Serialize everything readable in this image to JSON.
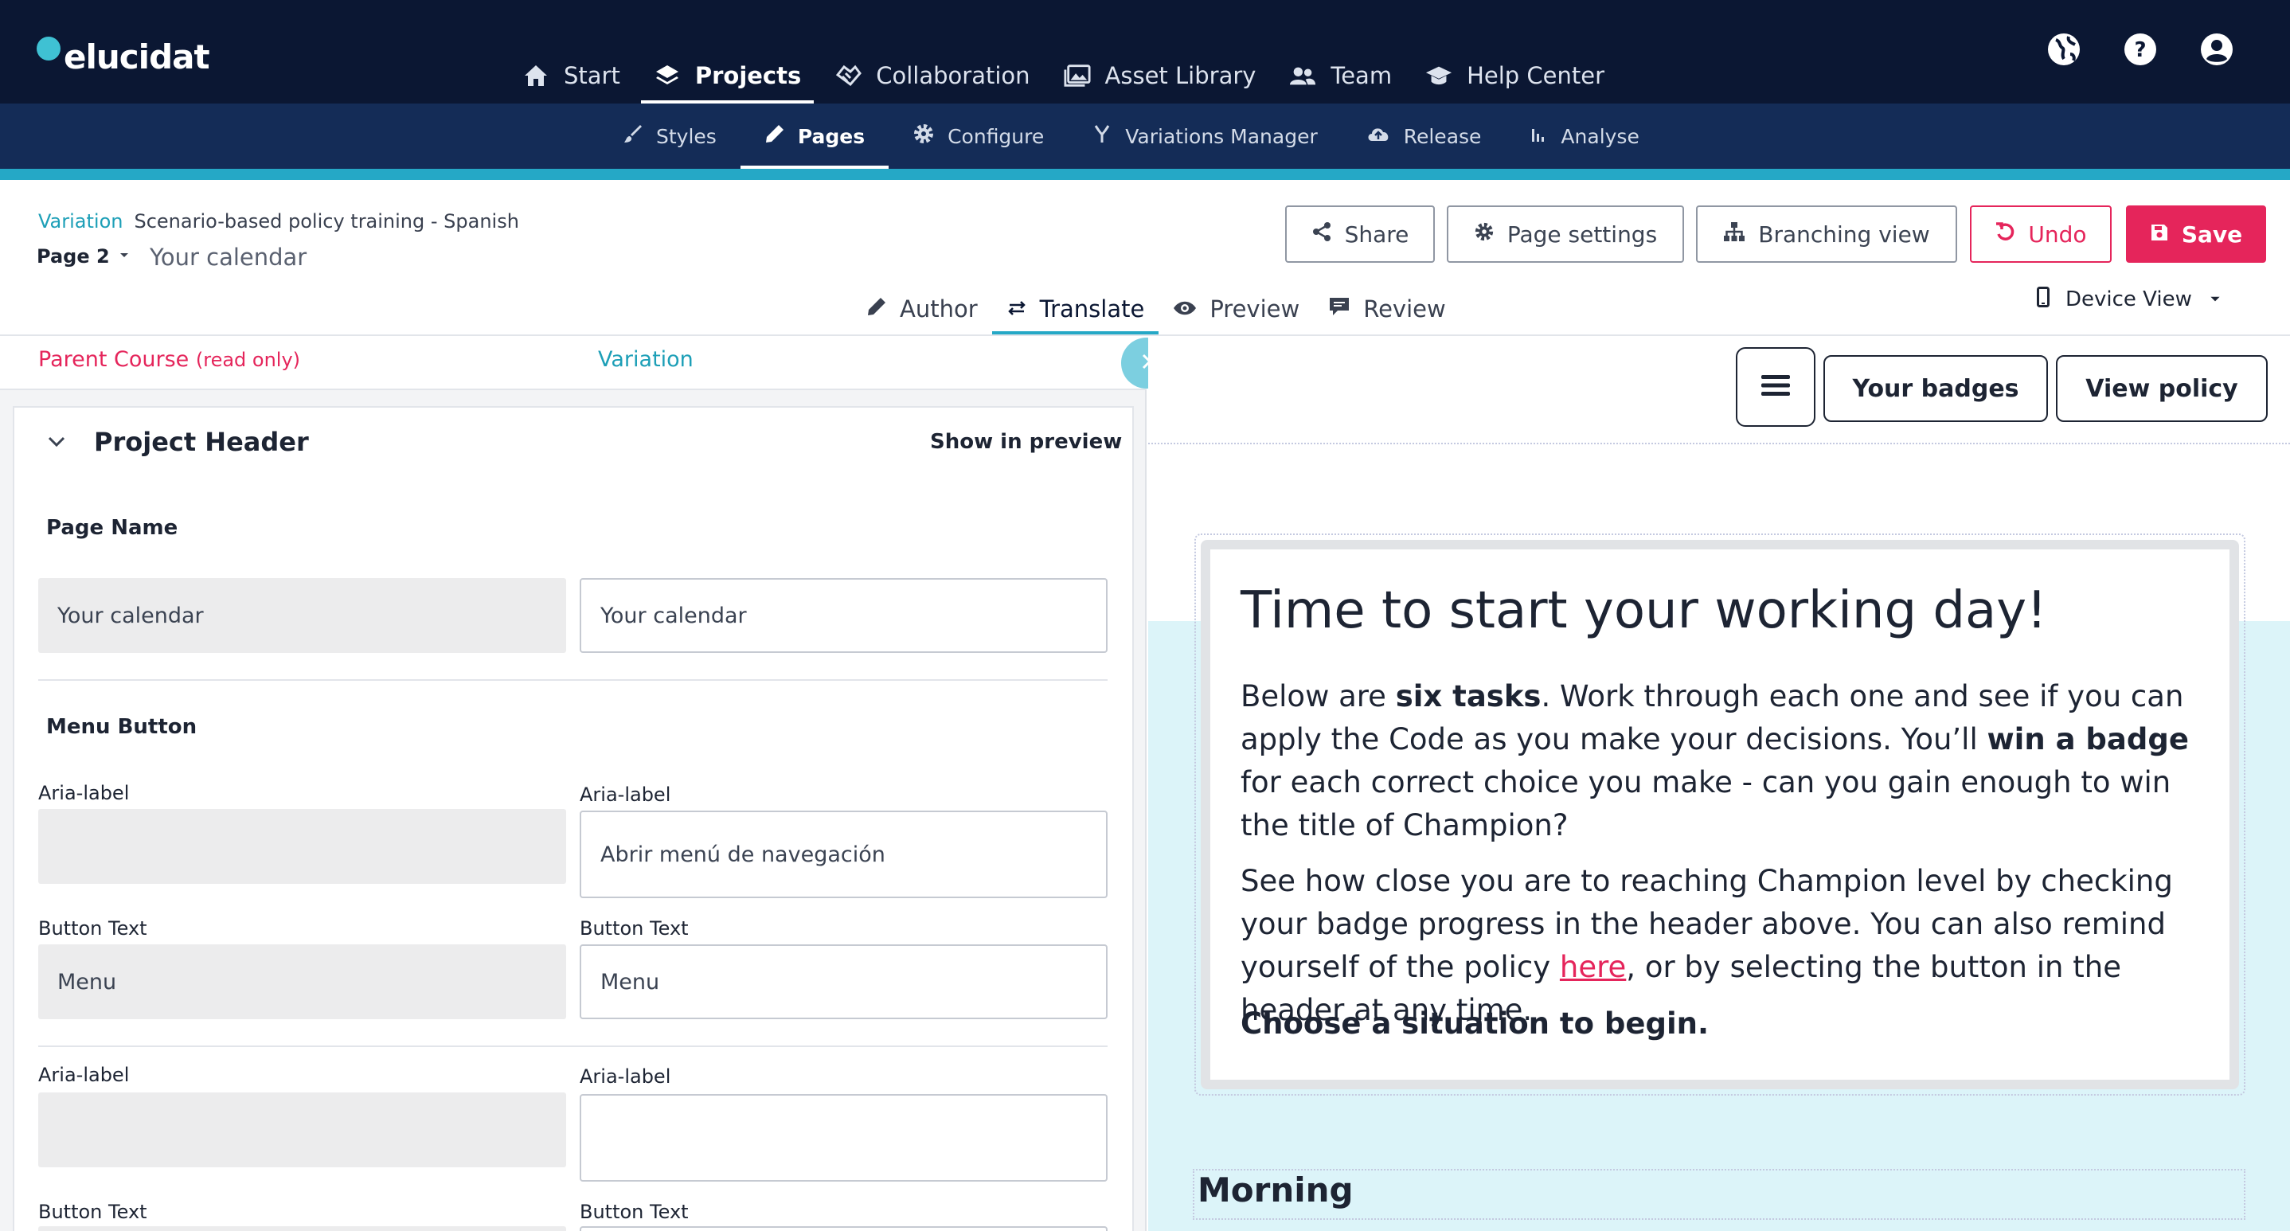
{
  "app": {
    "logo_text": "elucidat"
  },
  "main_nav": [
    {
      "label": "Start",
      "icon": "home-icon"
    },
    {
      "label": "Projects",
      "icon": "layers-icon",
      "active": true
    },
    {
      "label": "Collaboration",
      "icon": "collaboration-icon"
    },
    {
      "label": "Asset Library",
      "icon": "images-icon"
    },
    {
      "label": "Team",
      "icon": "team-icon"
    },
    {
      "label": "Help Center",
      "icon": "graduation-cap-icon"
    }
  ],
  "top_right_icons": [
    "globe-icon",
    "help-icon",
    "account-icon"
  ],
  "sub_nav": [
    {
      "label": "Styles",
      "icon": "brush-icon"
    },
    {
      "label": "Pages",
      "icon": "pencil-icon",
      "active": true
    },
    {
      "label": "Configure",
      "icon": "gear-icon"
    },
    {
      "label": "Variations Manager",
      "icon": "fork-icon"
    },
    {
      "label": "Release",
      "icon": "cloud-upload-icon"
    },
    {
      "label": "Analyse",
      "icon": "bar-chart-icon"
    }
  ],
  "header": {
    "variation_label": "Variation",
    "variation_name": "Scenario-based policy training - Spanish",
    "page_selector": "Page 2",
    "page_title": "Your calendar",
    "buttons": {
      "share": "Share",
      "page_settings": "Page settings",
      "branching_view": "Branching view",
      "undo": "Undo",
      "save": "Save"
    },
    "mode_tabs": [
      {
        "label": "Author",
        "icon": "pencil-icon"
      },
      {
        "label": "Translate",
        "icon": "swap-icon",
        "active": true
      },
      {
        "label": "Preview",
        "icon": "eye-icon"
      },
      {
        "label": "Review",
        "icon": "comment-icon"
      }
    ],
    "device_view": "Device View"
  },
  "left_panel": {
    "col_parent": "Parent Course",
    "col_parent_note": "(read only)",
    "col_variation": "Variation",
    "section_title": "Project Header",
    "show_in_preview": "Show in preview",
    "page_name": {
      "label": "Page Name",
      "parent_value": "Your calendar",
      "variation_value": "Your calendar"
    },
    "menu_button": {
      "title": "Menu Button",
      "aria_label": "Aria-label",
      "aria_parent": "",
      "aria_variation": "Abrir menú de navegación",
      "button_text_label": "Button Text",
      "text_parent": "Menu",
      "text_variation": "Menu"
    },
    "second_block": {
      "aria_label": "Aria-label",
      "aria_parent": "",
      "aria_variation": "",
      "button_text_label": "Button Text"
    }
  },
  "preview": {
    "badges_btn": "Your badges",
    "policy_btn": "View policy",
    "heading": "Time to start your working day!",
    "para1_a": "Below are ",
    "para1_b": "six tasks",
    "para1_c": ". Work through each one and see if you can apply the Code as you make your decisions. You’ll ",
    "para1_d": "win a badge",
    "para1_e": " for each correct choice you make - can you gain enough to win the title of Champion?",
    "para2_a": "See how close you are to reaching Champion level by checking your badge progress in the header above. You can also remind yourself of the policy ",
    "para2_link": "here",
    "para2_b": ", or by selecting the button in the header at any time.",
    "para3": "Choose a situation to begin.",
    "section": "Morning"
  }
}
